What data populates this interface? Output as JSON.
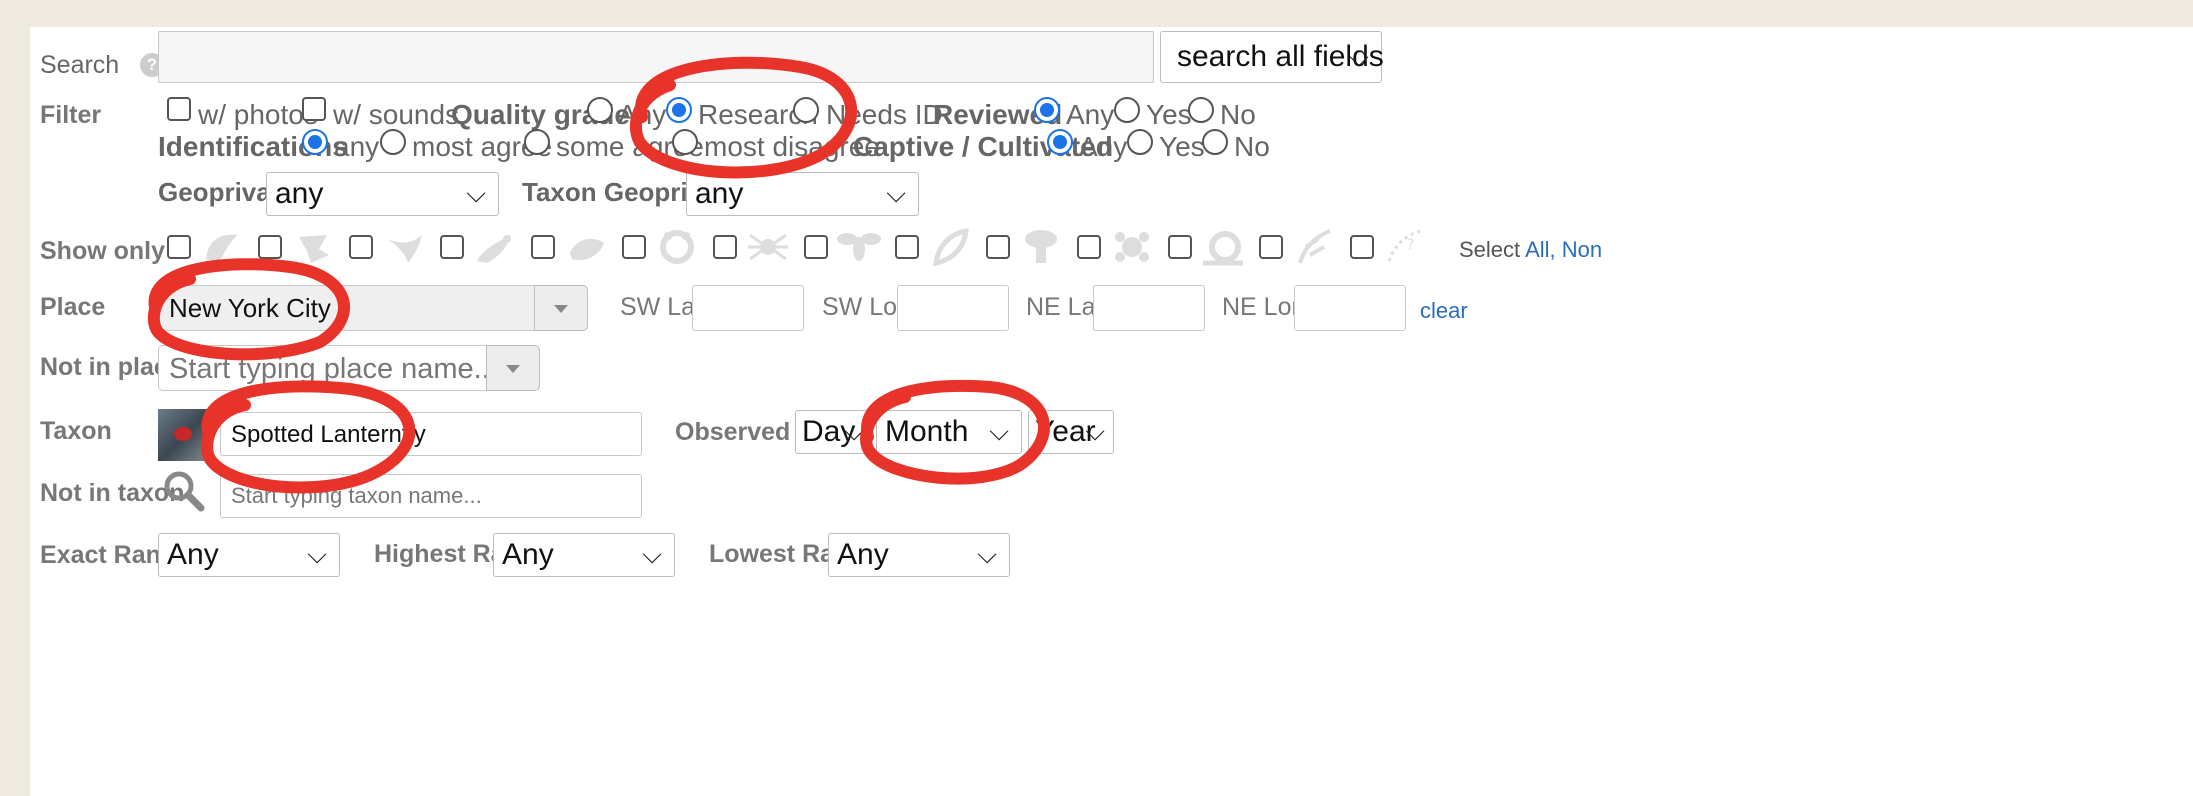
{
  "labels": {
    "search": "Search",
    "filter": "Filter",
    "show_only": "Show only",
    "place": "Place",
    "not_in_place": "Not in place",
    "taxon": "Taxon",
    "not_in_taxon": "Not in taxon",
    "exact_rank": "Exact Rank"
  },
  "search": {
    "value": "",
    "fields_select": "search all fields"
  },
  "filter": {
    "photos": "w/ photos",
    "sounds": "w/ sounds",
    "quality_grade_label": "Quality grade",
    "quality_any": "Any",
    "quality_research": "Research",
    "quality_needs_id": "Needs ID",
    "reviewed_label": "Reviewed",
    "reviewed_any": "Any",
    "reviewed_yes": "Yes",
    "reviewed_no": "No",
    "identifications_label": "Identifications",
    "id_any": "any",
    "id_most_agree": "most agree",
    "id_some_agree": "some agree",
    "id_most_disagree": "most disagree",
    "captive_label": "Captive / Cultivated",
    "captive_any": "Any",
    "captive_yes": "Yes",
    "captive_no": "No",
    "geoprivacy_label": "Geoprivacy",
    "geoprivacy_value": "any",
    "taxon_geoprivacy_label": "Taxon Geoprivacy",
    "taxon_geoprivacy_value": "any"
  },
  "show_only": {
    "icons": [
      "amphibia-icon",
      "plantae-icon",
      "aves-icon",
      "reptilia-icon",
      "amphibian-frog-icon",
      "mollusca-icon",
      "arachnida-icon",
      "insecta-icon",
      "plant-leaf-icon",
      "fungi-icon",
      "protozoa-icon",
      "snail-icon",
      "chromista-icon",
      "unknown-icon"
    ],
    "select_prefix": "Select",
    "select_all": "All",
    "select_none": "Non"
  },
  "place": {
    "value": "New York City",
    "sw_lat": "SW Lat.",
    "sw_lon": "SW Lon.",
    "ne_lat": "NE Lat.",
    "ne_lon": "NE Lon.",
    "clear": "clear"
  },
  "not_in_place": {
    "placeholder": "Start typing place name..."
  },
  "taxon": {
    "value": "Spotted Lanternfly",
    "observed_on": "Observed on",
    "day": "Day",
    "month": "Month",
    "year": "Year"
  },
  "not_in_taxon": {
    "placeholder": "Start typing taxon name..."
  },
  "ranks": {
    "exact_value": "Any",
    "highest_label": "Highest Rank",
    "highest_value": "Any",
    "lowest_label": "Lowest Rank",
    "lowest_value": "Any"
  },
  "colors": {
    "annotation": "#e8332a",
    "link": "#2a6ebb",
    "radio_selected": "#1a73e8",
    "background": "#efeae0"
  }
}
